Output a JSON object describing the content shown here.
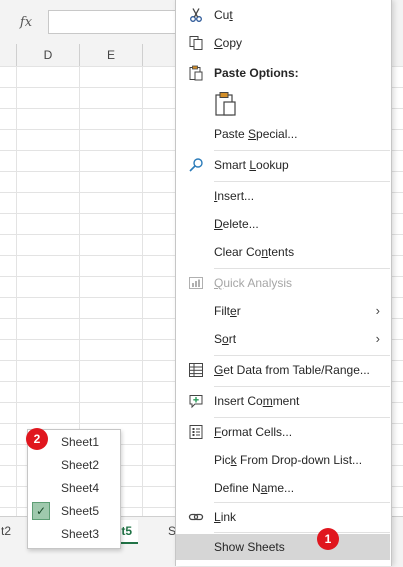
{
  "formula_bar": {
    "fx_label": "fx"
  },
  "columns": [
    "D",
    "E"
  ],
  "tabs": {
    "left_partial": "t2",
    "active": "eet5",
    "right_partial": "S"
  },
  "sheet_popup": {
    "items": [
      {
        "label": "Sheet1",
        "checked": false
      },
      {
        "label": "Sheet2",
        "checked": false
      },
      {
        "label": "Sheet4",
        "checked": false
      },
      {
        "label": "Sheet5",
        "checked": true
      },
      {
        "label": "Sheet3",
        "checked": false
      }
    ],
    "check_mark": "✓"
  },
  "badges": {
    "one": "1",
    "two": "2"
  },
  "context_menu": {
    "cut": {
      "pre": "Cu",
      "key": "t",
      "post": ""
    },
    "copy": {
      "pre": "",
      "key": "C",
      "post": "opy"
    },
    "paste_options": "Paste Options:",
    "paste_special": {
      "pre": "Paste ",
      "key": "S",
      "post": "pecial..."
    },
    "smart_lookup": {
      "pre": "Smart ",
      "key": "L",
      "post": "ookup"
    },
    "insert": {
      "pre": "",
      "key": "I",
      "post": "nsert..."
    },
    "delete": {
      "pre": "",
      "key": "D",
      "post": "elete..."
    },
    "clear_contents": {
      "pre": "Clear Co",
      "key": "n",
      "post": "tents"
    },
    "quick_analysis": {
      "pre": "",
      "key": "Q",
      "post": "uick Analysis"
    },
    "filter": {
      "pre": "Filt",
      "key": "e",
      "post": "r"
    },
    "sort": {
      "pre": "S",
      "key": "o",
      "post": "rt"
    },
    "get_data": {
      "pre": "",
      "key": "G",
      "post": "et Data from Table/Range..."
    },
    "insert_comment": {
      "pre": "Insert Co",
      "key": "m",
      "post": "ment"
    },
    "format_cells": {
      "pre": "",
      "key": "F",
      "post": "ormat Cells..."
    },
    "pick_dropdown": {
      "pre": "Pic",
      "key": "k",
      "post": " From Drop-down List..."
    },
    "define_name": {
      "pre": "Define N",
      "key": "a",
      "post": "me..."
    },
    "link": {
      "pre": "",
      "key": "L",
      "post": "ink"
    },
    "show_sheets": "Show Sheets"
  },
  "colors": {
    "excel_green": "#217346",
    "badge_red": "#e0161e",
    "highlight": "#d6d6d6"
  }
}
